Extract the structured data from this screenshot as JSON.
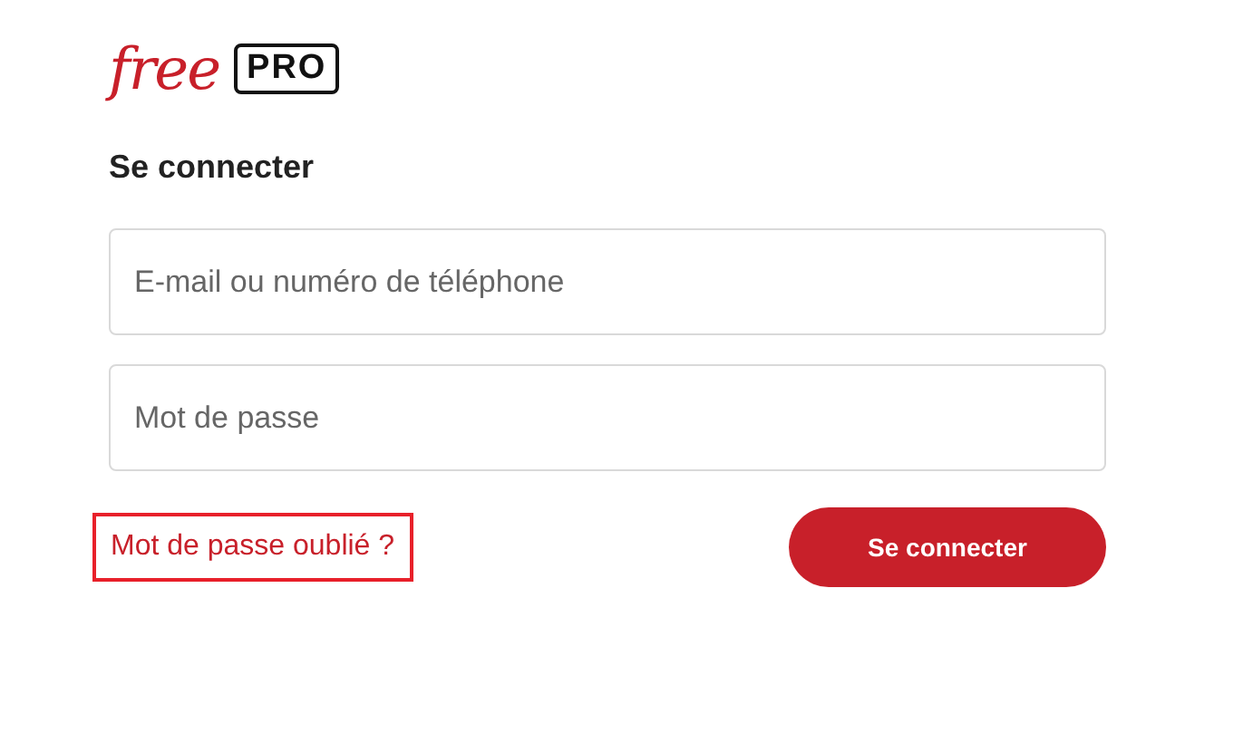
{
  "logo": {
    "brand": "free",
    "badge": "PRO"
  },
  "heading": "Se connecter",
  "fields": [
    {
      "placeholder": "E-mail ou numéro de téléphone"
    },
    {
      "placeholder": "Mot de passe"
    }
  ],
  "forgot_link": {
    "label": "Mot de passe oublié ?",
    "highlighted": true
  },
  "submit_button": {
    "label": "Se connecter"
  }
}
